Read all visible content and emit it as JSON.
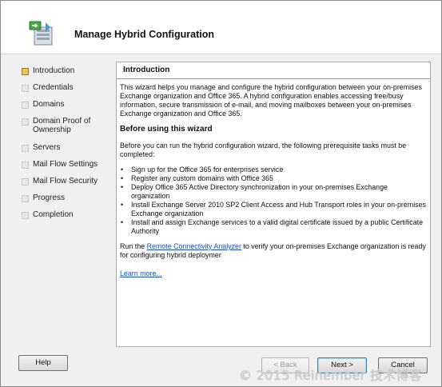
{
  "window": {
    "title": "Manage Hybrid Configuration",
    "icon": "hybrid-config-wizard-icon"
  },
  "steps": [
    {
      "label": "Introduction",
      "state": "active"
    },
    {
      "label": "Credentials",
      "state": "pending"
    },
    {
      "label": "Domains",
      "state": "pending"
    },
    {
      "label": "Domain Proof of Ownership",
      "state": "pending"
    },
    {
      "label": "Servers",
      "state": "pending"
    },
    {
      "label": "Mail Flow Settings",
      "state": "pending"
    },
    {
      "label": "Mail Flow Security",
      "state": "pending"
    },
    {
      "label": "Progress",
      "state": "pending"
    },
    {
      "label": "Completion",
      "state": "pending"
    }
  ],
  "content": {
    "title": "Introduction",
    "intro": "This wizard helps you manage and configure the hybrid configuration between your on-premises Exchange organization and Office 365. A hybrid configuration enables accessing free/busy information, secure transmission of e-mail, and moving mailboxes between your on-premises Exchange organization and Office 365.",
    "before_heading": "Before using this wizard",
    "before_text": "Before you can run the hybrid configuration wizard, the following prerequisite tasks must be completed:",
    "prerequisites": [
      "Sign up for the Office 365 for enterprises service",
      "Register any custom domains with Office 365",
      "Deploy Office 365 Active Directory synchronization in your on-premises Exchange organization",
      "Install Exchange Server 2010 SP2 Client Access and Hub Transport roles in your on-premises Exchange organization",
      "Install and assign Exchange services to a valid digital certificate issued by a public Certificate Authority"
    ],
    "rca_prefix": "Run the ",
    "rca_link": "Remote Connectivity Analyzer",
    "rca_suffix": " to verify your on-premises Exchange organization is ready for configuring hybrid deploymer",
    "learn_more": "Learn more..."
  },
  "buttons": {
    "help": "Help",
    "back": "< Back",
    "next": "Next >",
    "cancel": "Cancel"
  },
  "watermark": "© 2015 Reinember 技术博客"
}
